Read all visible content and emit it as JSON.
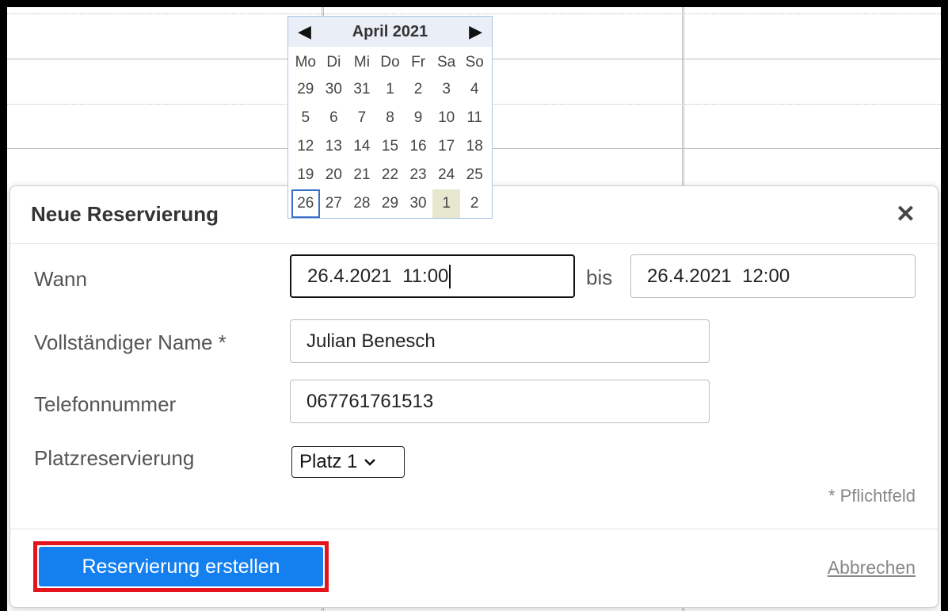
{
  "calendar": {
    "title": "April 2021",
    "prev_icon": "◀",
    "next_icon": "▶",
    "weekdays": [
      "Mo",
      "Di",
      "Mi",
      "Do",
      "Fr",
      "Sa",
      "So"
    ],
    "weeks": [
      [
        "29",
        "30",
        "31",
        "1",
        "2",
        "3",
        "4"
      ],
      [
        "5",
        "6",
        "7",
        "8",
        "9",
        "10",
        "11"
      ],
      [
        "12",
        "13",
        "14",
        "15",
        "16",
        "17",
        "18"
      ],
      [
        "19",
        "20",
        "21",
        "22",
        "23",
        "24",
        "25"
      ],
      [
        "26",
        "27",
        "28",
        "29",
        "30",
        "1",
        "2"
      ]
    ],
    "selected_day": "26",
    "highlighted_day": "1"
  },
  "dialog": {
    "title": "Neue Reservierung",
    "close_icon": "✕",
    "when_label": "Wann",
    "from_value": "26.4.2021  11:00",
    "to_label": "bis",
    "to_value": "26.4.2021  12:00",
    "name_label": "Vollständiger Name *",
    "name_value": "Julian Benesch",
    "phone_label": "Telefonnummer",
    "phone_value": "067761761513",
    "seat_label": "Platzreservierung",
    "seat_value": "Platz 1",
    "required_note": "* Pflichtfeld",
    "create_label": "Reservierung erstellen",
    "cancel_label": "Abbrechen"
  },
  "colors": {
    "primary_button": "#1480f0",
    "highlight_outline": "#e3141b",
    "calendar_header": "#e9eef7"
  }
}
